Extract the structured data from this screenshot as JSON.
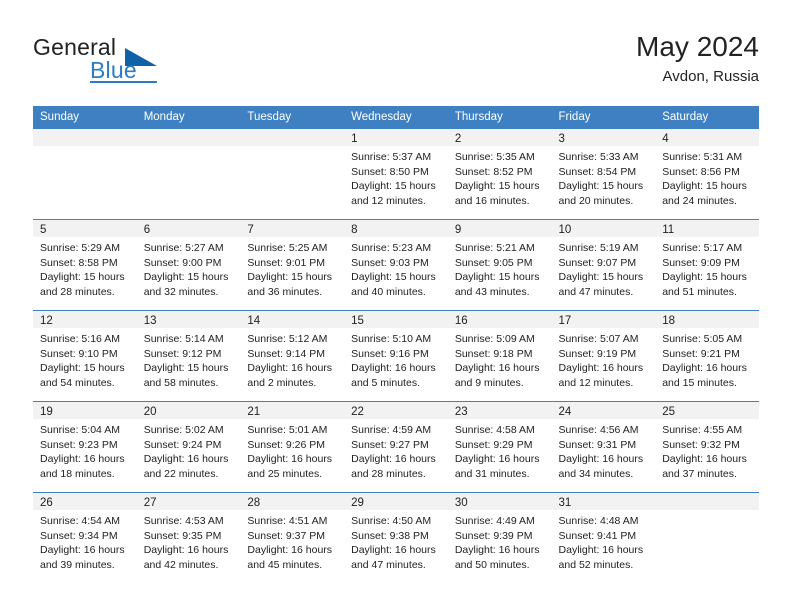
{
  "brand": {
    "name_part1": "General",
    "name_part2": "Blue",
    "triangle_color": "#1062a8",
    "accent_color": "#2b7cc4"
  },
  "header": {
    "month_title": "May 2024",
    "location": "Avdon, Russia",
    "header_bg": "#3f80c2",
    "daynum_bg": "#f2f2f2"
  },
  "weekday_headers": [
    "Sunday",
    "Monday",
    "Tuesday",
    "Wednesday",
    "Thursday",
    "Friday",
    "Saturday"
  ],
  "weeks": [
    [
      {
        "day": "",
        "blank": true
      },
      {
        "day": "",
        "blank": true
      },
      {
        "day": "",
        "blank": true
      },
      {
        "day": "1",
        "sunrise": "Sunrise: 5:37 AM",
        "sunset": "Sunset: 8:50 PM",
        "daylight_line1": "Daylight: 15 hours",
        "daylight_line2": "and 12 minutes."
      },
      {
        "day": "2",
        "sunrise": "Sunrise: 5:35 AM",
        "sunset": "Sunset: 8:52 PM",
        "daylight_line1": "Daylight: 15 hours",
        "daylight_line2": "and 16 minutes."
      },
      {
        "day": "3",
        "sunrise": "Sunrise: 5:33 AM",
        "sunset": "Sunset: 8:54 PM",
        "daylight_line1": "Daylight: 15 hours",
        "daylight_line2": "and 20 minutes."
      },
      {
        "day": "4",
        "sunrise": "Sunrise: 5:31 AM",
        "sunset": "Sunset: 8:56 PM",
        "daylight_line1": "Daylight: 15 hours",
        "daylight_line2": "and 24 minutes."
      }
    ],
    [
      {
        "day": "5",
        "sunrise": "Sunrise: 5:29 AM",
        "sunset": "Sunset: 8:58 PM",
        "daylight_line1": "Daylight: 15 hours",
        "daylight_line2": "and 28 minutes."
      },
      {
        "day": "6",
        "sunrise": "Sunrise: 5:27 AM",
        "sunset": "Sunset: 9:00 PM",
        "daylight_line1": "Daylight: 15 hours",
        "daylight_line2": "and 32 minutes."
      },
      {
        "day": "7",
        "sunrise": "Sunrise: 5:25 AM",
        "sunset": "Sunset: 9:01 PM",
        "daylight_line1": "Daylight: 15 hours",
        "daylight_line2": "and 36 minutes."
      },
      {
        "day": "8",
        "sunrise": "Sunrise: 5:23 AM",
        "sunset": "Sunset: 9:03 PM",
        "daylight_line1": "Daylight: 15 hours",
        "daylight_line2": "and 40 minutes."
      },
      {
        "day": "9",
        "sunrise": "Sunrise: 5:21 AM",
        "sunset": "Sunset: 9:05 PM",
        "daylight_line1": "Daylight: 15 hours",
        "daylight_line2": "and 43 minutes."
      },
      {
        "day": "10",
        "sunrise": "Sunrise: 5:19 AM",
        "sunset": "Sunset: 9:07 PM",
        "daylight_line1": "Daylight: 15 hours",
        "daylight_line2": "and 47 minutes."
      },
      {
        "day": "11",
        "sunrise": "Sunrise: 5:17 AM",
        "sunset": "Sunset: 9:09 PM",
        "daylight_line1": "Daylight: 15 hours",
        "daylight_line2": "and 51 minutes."
      }
    ],
    [
      {
        "day": "12",
        "sunrise": "Sunrise: 5:16 AM",
        "sunset": "Sunset: 9:10 PM",
        "daylight_line1": "Daylight: 15 hours",
        "daylight_line2": "and 54 minutes."
      },
      {
        "day": "13",
        "sunrise": "Sunrise: 5:14 AM",
        "sunset": "Sunset: 9:12 PM",
        "daylight_line1": "Daylight: 15 hours",
        "daylight_line2": "and 58 minutes."
      },
      {
        "day": "14",
        "sunrise": "Sunrise: 5:12 AM",
        "sunset": "Sunset: 9:14 PM",
        "daylight_line1": "Daylight: 16 hours",
        "daylight_line2": "and 2 minutes."
      },
      {
        "day": "15",
        "sunrise": "Sunrise: 5:10 AM",
        "sunset": "Sunset: 9:16 PM",
        "daylight_line1": "Daylight: 16 hours",
        "daylight_line2": "and 5 minutes."
      },
      {
        "day": "16",
        "sunrise": "Sunrise: 5:09 AM",
        "sunset": "Sunset: 9:18 PM",
        "daylight_line1": "Daylight: 16 hours",
        "daylight_line2": "and 9 minutes."
      },
      {
        "day": "17",
        "sunrise": "Sunrise: 5:07 AM",
        "sunset": "Sunset: 9:19 PM",
        "daylight_line1": "Daylight: 16 hours",
        "daylight_line2": "and 12 minutes."
      },
      {
        "day": "18",
        "sunrise": "Sunrise: 5:05 AM",
        "sunset": "Sunset: 9:21 PM",
        "daylight_line1": "Daylight: 16 hours",
        "daylight_line2": "and 15 minutes."
      }
    ],
    [
      {
        "day": "19",
        "sunrise": "Sunrise: 5:04 AM",
        "sunset": "Sunset: 9:23 PM",
        "daylight_line1": "Daylight: 16 hours",
        "daylight_line2": "and 18 minutes."
      },
      {
        "day": "20",
        "sunrise": "Sunrise: 5:02 AM",
        "sunset": "Sunset: 9:24 PM",
        "daylight_line1": "Daylight: 16 hours",
        "daylight_line2": "and 22 minutes."
      },
      {
        "day": "21",
        "sunrise": "Sunrise: 5:01 AM",
        "sunset": "Sunset: 9:26 PM",
        "daylight_line1": "Daylight: 16 hours",
        "daylight_line2": "and 25 minutes."
      },
      {
        "day": "22",
        "sunrise": "Sunrise: 4:59 AM",
        "sunset": "Sunset: 9:27 PM",
        "daylight_line1": "Daylight: 16 hours",
        "daylight_line2": "and 28 minutes."
      },
      {
        "day": "23",
        "sunrise": "Sunrise: 4:58 AM",
        "sunset": "Sunset: 9:29 PM",
        "daylight_line1": "Daylight: 16 hours",
        "daylight_line2": "and 31 minutes."
      },
      {
        "day": "24",
        "sunrise": "Sunrise: 4:56 AM",
        "sunset": "Sunset: 9:31 PM",
        "daylight_line1": "Daylight: 16 hours",
        "daylight_line2": "and 34 minutes."
      },
      {
        "day": "25",
        "sunrise": "Sunrise: 4:55 AM",
        "sunset": "Sunset: 9:32 PM",
        "daylight_line1": "Daylight: 16 hours",
        "daylight_line2": "and 37 minutes."
      }
    ],
    [
      {
        "day": "26",
        "sunrise": "Sunrise: 4:54 AM",
        "sunset": "Sunset: 9:34 PM",
        "daylight_line1": "Daylight: 16 hours",
        "daylight_line2": "and 39 minutes."
      },
      {
        "day": "27",
        "sunrise": "Sunrise: 4:53 AM",
        "sunset": "Sunset: 9:35 PM",
        "daylight_line1": "Daylight: 16 hours",
        "daylight_line2": "and 42 minutes."
      },
      {
        "day": "28",
        "sunrise": "Sunrise: 4:51 AM",
        "sunset": "Sunset: 9:37 PM",
        "daylight_line1": "Daylight: 16 hours",
        "daylight_line2": "and 45 minutes."
      },
      {
        "day": "29",
        "sunrise": "Sunrise: 4:50 AM",
        "sunset": "Sunset: 9:38 PM",
        "daylight_line1": "Daylight: 16 hours",
        "daylight_line2": "and 47 minutes."
      },
      {
        "day": "30",
        "sunrise": "Sunrise: 4:49 AM",
        "sunset": "Sunset: 9:39 PM",
        "daylight_line1": "Daylight: 16 hours",
        "daylight_line2": "and 50 minutes."
      },
      {
        "day": "31",
        "sunrise": "Sunrise: 4:48 AM",
        "sunset": "Sunset: 9:41 PM",
        "daylight_line1": "Daylight: 16 hours",
        "daylight_line2": "and 52 minutes."
      },
      {
        "day": "",
        "blank": true
      }
    ]
  ]
}
